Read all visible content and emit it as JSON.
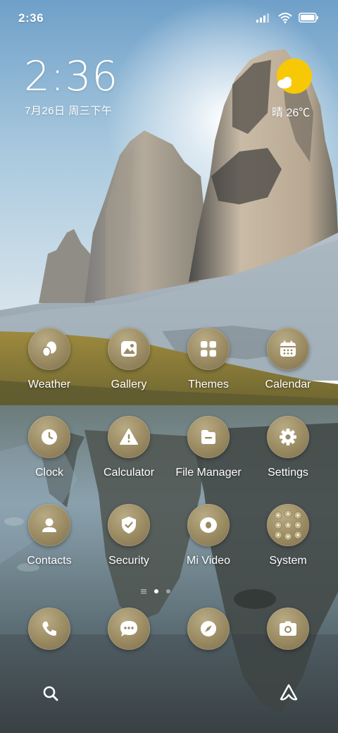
{
  "status_bar": {
    "time": "2:36",
    "icons": [
      "signal-icon",
      "wifi-icon",
      "battery-icon"
    ]
  },
  "clock_widget": {
    "time": "2:36",
    "date": "7月26日 周三下午"
  },
  "weather_widget": {
    "condition_icon": "sun-cloud-icon",
    "text": "晴 26℃"
  },
  "apps": [
    {
      "label": "Weather",
      "icon": "weather-egg-icon"
    },
    {
      "label": "Gallery",
      "icon": "gallery-icon"
    },
    {
      "label": "Themes",
      "icon": "themes-grid-icon"
    },
    {
      "label": "Calendar",
      "icon": "calendar-icon"
    },
    {
      "label": "Clock",
      "icon": "clock-icon"
    },
    {
      "label": "Calculator",
      "icon": "warning-triangle-icon"
    },
    {
      "label": "File Manager",
      "icon": "folder-icon"
    },
    {
      "label": "Settings",
      "icon": "gear-icon"
    },
    {
      "label": "Contacts",
      "icon": "person-icon"
    },
    {
      "label": "Security",
      "icon": "shield-icon"
    },
    {
      "label": "Mi Video",
      "icon": "video-icon"
    },
    {
      "label": "System",
      "icon": "folder-grid-icon"
    }
  ],
  "page_indicator": {
    "pages": 2,
    "current": 1
  },
  "dock": [
    {
      "icon": "phone-icon"
    },
    {
      "icon": "message-icon"
    },
    {
      "icon": "compass-icon"
    },
    {
      "icon": "camera-icon"
    }
  ],
  "bottom_bar": {
    "left_icon": "search-icon",
    "right_icon": "assistant-icon"
  },
  "colors": {
    "icon_gold": "#9a8a62",
    "sun": "#f7c806"
  }
}
